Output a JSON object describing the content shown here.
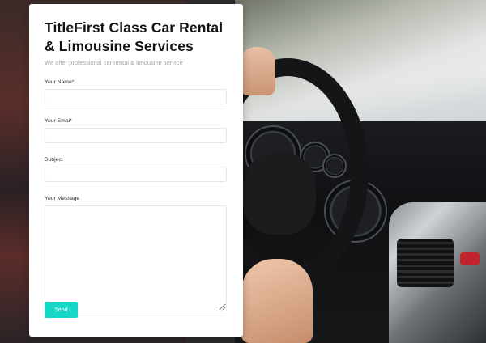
{
  "form": {
    "title": "TitleFirst Class Car Rental & Limousine Services",
    "subtitle": "We offer professional car rental & limousine service",
    "name_label": "Your Name*",
    "name_value": "",
    "email_label": "Your Emai*",
    "email_value": "",
    "subject_label": "Subject",
    "subject_value": "",
    "message_label": "Your Message",
    "message_value": "",
    "send_label": "Send"
  },
  "colors": {
    "accent": "#17d8c6",
    "card_bg": "#ffffff",
    "title": "#141414",
    "subtitle": "#a6a6a6"
  },
  "background": {
    "image_subject": "car-interior-steering-wheel-photo"
  }
}
